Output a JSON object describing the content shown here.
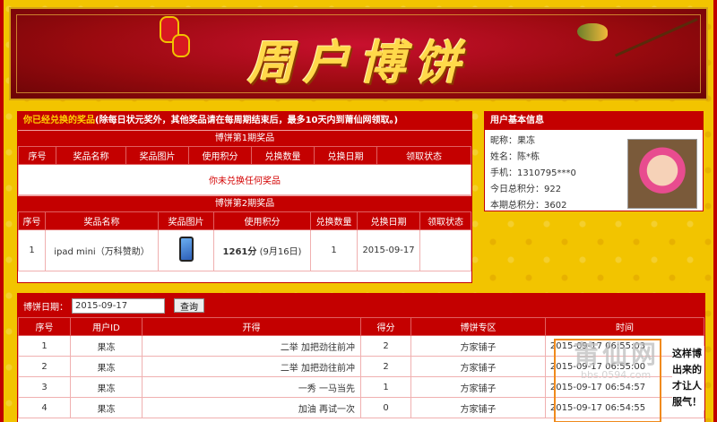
{
  "banner": {
    "title": "周户博饼"
  },
  "prize_panel": {
    "header": "你已经兑换的奖品",
    "note": "(除每日状元奖外，其他奖品请在每周期结束后，最多10天内到莆仙网领取。)",
    "period1": {
      "title": "博饼第1期奖品",
      "columns": [
        "序号",
        "奖品名称",
        "奖品图片",
        "使用积分",
        "兑换数量",
        "兑换日期",
        "领取状态"
      ],
      "empty_text": "你未兑换任何奖品"
    },
    "period2": {
      "title": "博饼第2期奖品",
      "columns": [
        "序号",
        "奖品名称",
        "奖品图片",
        "使用积分",
        "兑换数量",
        "兑换日期",
        "领取状态"
      ],
      "rows": [
        {
          "index": "1",
          "name": "ipad mini（万科赞助）",
          "image_icon": "ipad-icon",
          "points": "1261分",
          "points_date": "(9月16日)",
          "qty": "1",
          "date": "2015-09-17",
          "status": ""
        }
      ]
    }
  },
  "user_info": {
    "header": "用户基本信息",
    "lines": [
      "昵称：果冻",
      "姓名：陈*栋",
      "手机：1310795***0",
      "今日总积分：922",
      "本期总积分：3602"
    ]
  },
  "records": {
    "search_label": "博饼日期：",
    "date_value": "2015-09-17",
    "search_button": "查询",
    "columns": [
      "序号",
      "用户ID",
      "开得",
      "得分",
      "博饼专区",
      "时间"
    ],
    "rows": [
      {
        "index": "1",
        "user": "果冻",
        "result": "二举 加把劲往前冲",
        "score": "2",
        "zone": "方家铺子",
        "time": "2015-09-17 06:55:03"
      },
      {
        "index": "2",
        "user": "果冻",
        "result": "二举 加把劲往前冲",
        "score": "2",
        "zone": "方家铺子",
        "time": "2015-09-17 06:55:00"
      },
      {
        "index": "3",
        "user": "果冻",
        "result": "一秀 一马当先",
        "score": "1",
        "zone": "方家铺子",
        "time": "2015-09-17 06:54:57"
      },
      {
        "index": "4",
        "user": "果冻",
        "result": "加油 再试一次",
        "score": "0",
        "zone": "方家铺子",
        "time": "2015-09-17 06:54:55"
      }
    ],
    "side_note": "这样博出来的才让人服气！"
  },
  "watermark": {
    "text": "莆仙网",
    "sub": "bbs.0594.com"
  }
}
